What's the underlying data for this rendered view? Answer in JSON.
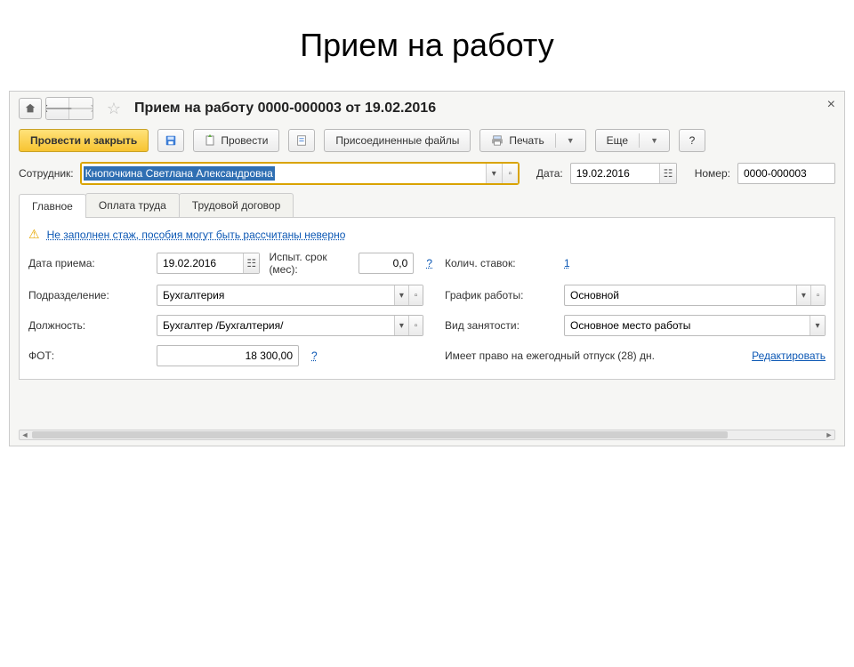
{
  "slide": {
    "title": "Прием на работу"
  },
  "window": {
    "title": "Прием на работу 0000-000003 от 19.02.2016"
  },
  "toolbar": {
    "post_close": "Провести и закрыть",
    "post": "Провести",
    "attached": "Присоединенные файлы",
    "print": "Печать",
    "more": "Еще"
  },
  "header_form": {
    "employee_label": "Сотрудник:",
    "employee_value": "Кнопочкина Светлана Александровна",
    "date_label": "Дата:",
    "date_value": "19.02.2016",
    "number_label": "Номер:",
    "number_value": "0000-000003"
  },
  "tabs": {
    "main": "Главное",
    "payment": "Оплата труда",
    "contract": "Трудовой договор"
  },
  "main_tab": {
    "warning": "Не заполнен стаж, пособия могут быть рассчитаны неверно",
    "hire_date_label": "Дата приема:",
    "hire_date": "19.02.2016",
    "probation_label": "Испыт. срок (мес):",
    "probation": "0,0",
    "rates_label": "Колич. ставок:",
    "rates": "1",
    "department_label": "Подразделение:",
    "department": "Бухгалтерия",
    "schedule_label": "График работы:",
    "schedule": "Основной",
    "position_label": "Должность:",
    "position": "Бухгалтер /Бухгалтерия/",
    "employment_label": "Вид занятости:",
    "employment": "Основное место работы",
    "fot_label": "ФОТ:",
    "fot": "18 300,00",
    "vacation_note": "Имеет право на ежегодный отпуск (28) дн.",
    "edit": "Редактировать"
  }
}
